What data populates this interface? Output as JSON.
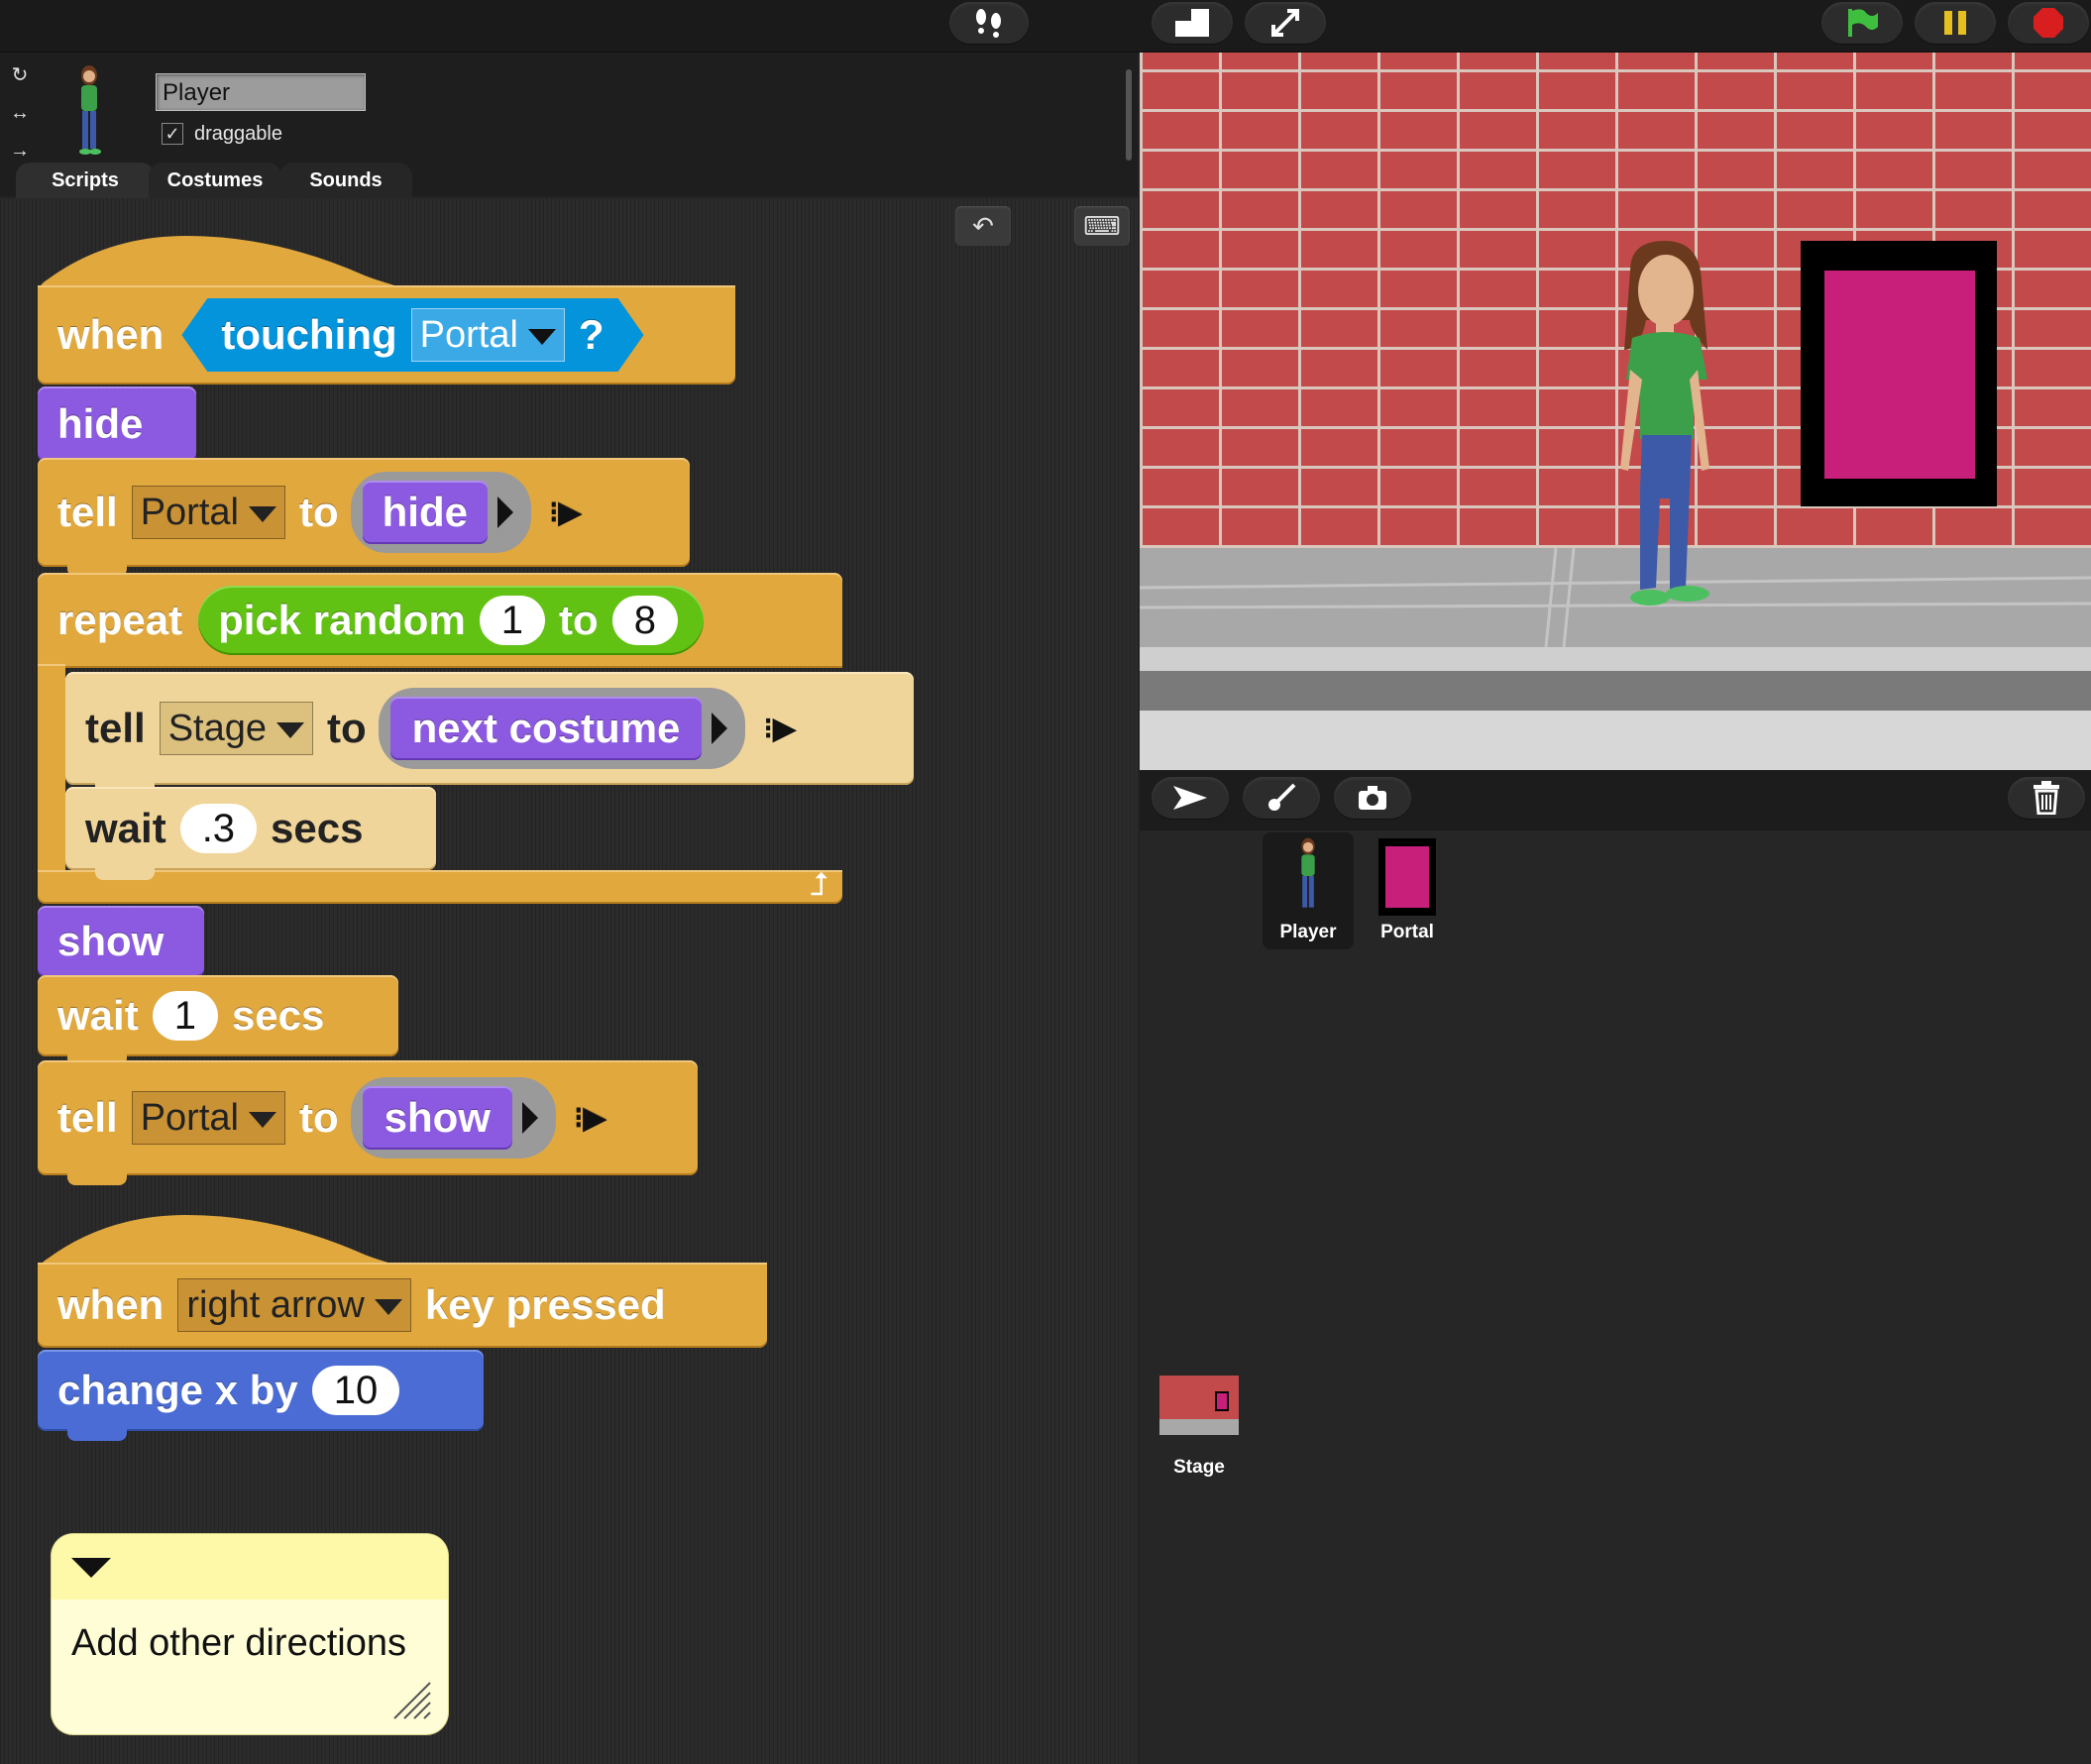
{
  "sprite": {
    "name": "Player",
    "draggable_label": "draggable",
    "draggable_checked": "✓"
  },
  "tabs": [
    "Scripts",
    "Costumes",
    "Sounds"
  ],
  "scripts": {
    "script1": {
      "when": "when",
      "touching": "touching",
      "touching_target": "Portal",
      "q": "?",
      "hide": "hide",
      "tell1": "tell",
      "tell1_target": "Portal",
      "to1": "to",
      "tell1_action": "hide",
      "repeat": "repeat",
      "pick_random": "pick random",
      "rand_from": "1",
      "rand_to_label": "to",
      "rand_to": "8",
      "tell2": "tell",
      "tell2_target": "Stage",
      "to2": "to",
      "tell2_action": "next costume",
      "wait1": "wait",
      "wait1_val": ".3",
      "secs1": "secs",
      "show": "show",
      "wait2": "wait",
      "wait2_val": "1",
      "secs2": "secs",
      "tell3": "tell",
      "tell3_target": "Portal",
      "to3": "to",
      "tell3_action": "show"
    },
    "script2": {
      "when": "when",
      "key": "right arrow",
      "key_pressed": "key pressed",
      "change_x": "change x by",
      "change_val": "10"
    },
    "comment": "Add other directions"
  },
  "corral": {
    "sprites": [
      "Player",
      "Portal"
    ],
    "stage_label": "Stage"
  },
  "colors": {
    "control": "#e1a83e",
    "looks": "#8c5ae0",
    "motion": "#4a6cd4",
    "operators": "#62c213",
    "sensing": "#0494dc",
    "portal": "#c71f7a"
  }
}
